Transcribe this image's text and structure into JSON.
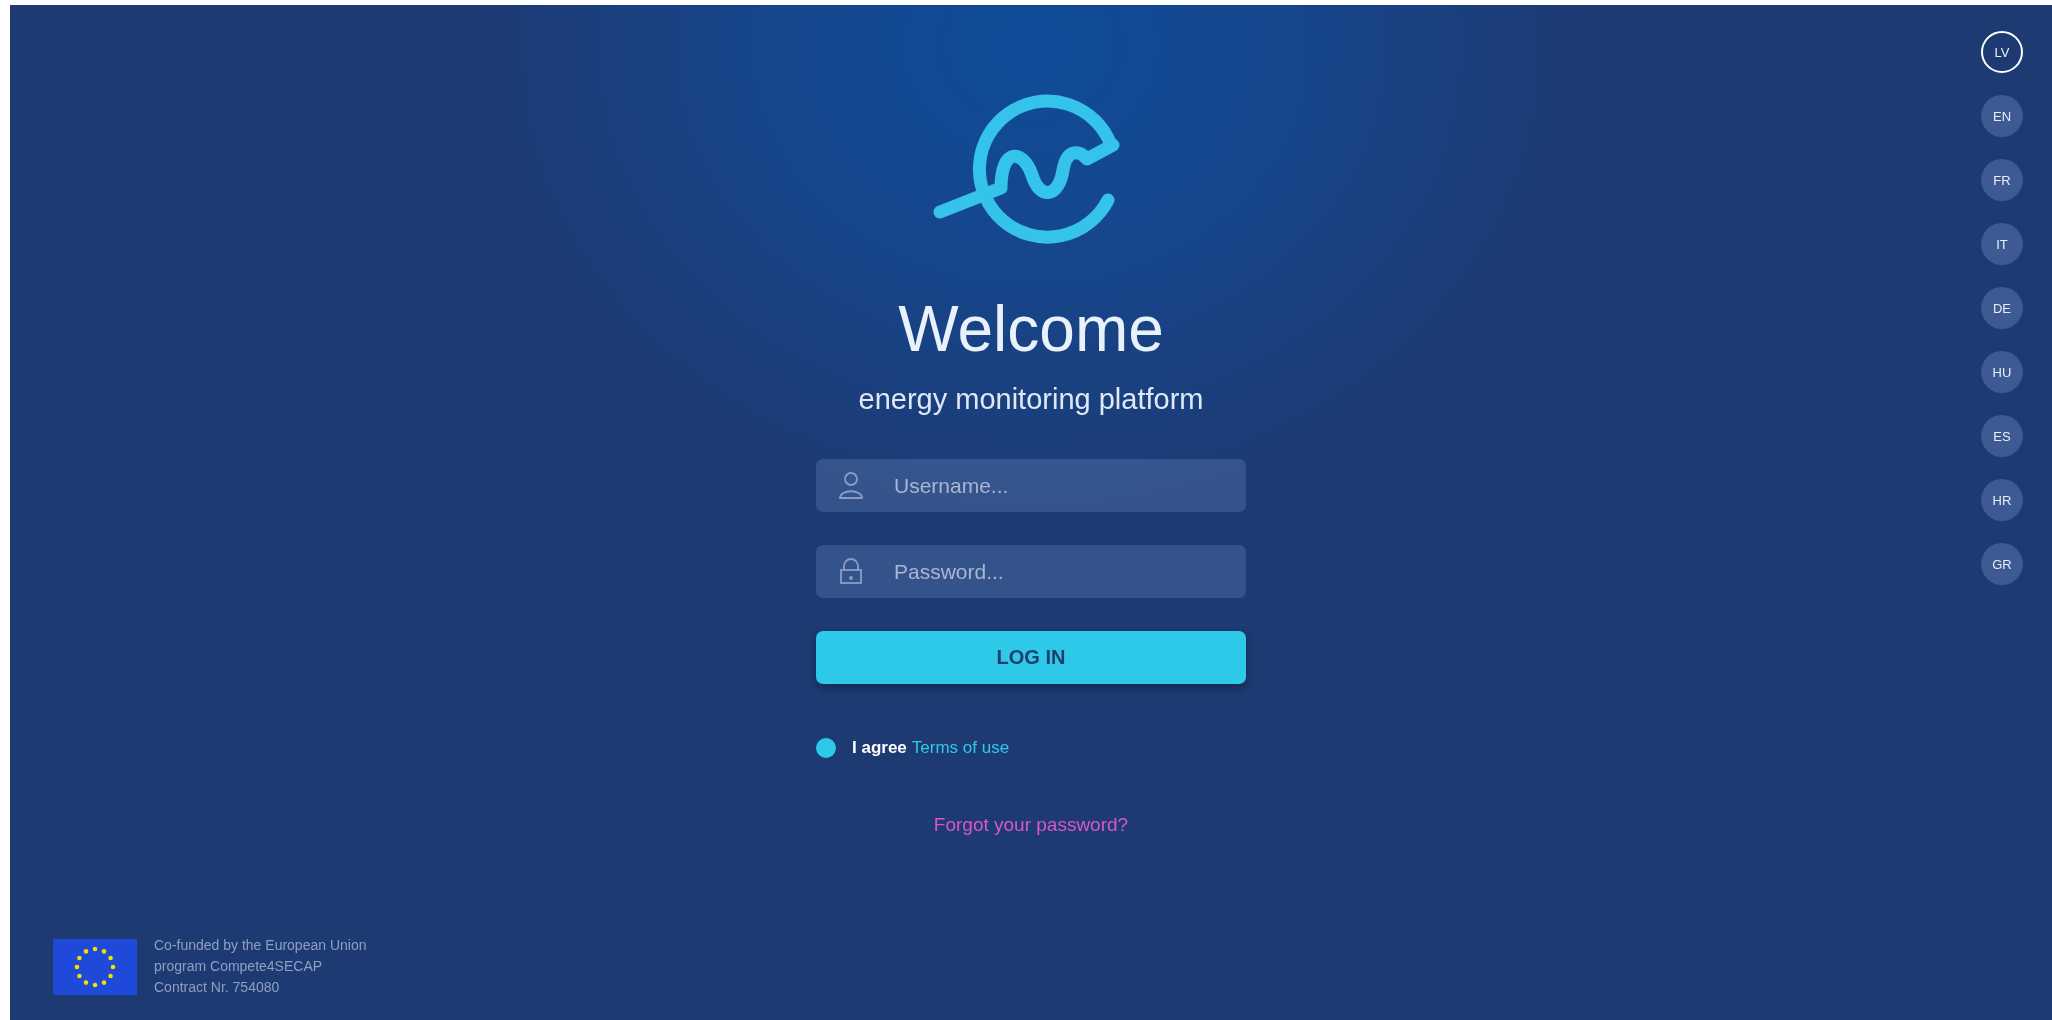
{
  "heading": "Welcome",
  "subtitle": "energy monitoring platform",
  "username": {
    "placeholder": "Username..."
  },
  "password": {
    "placeholder": "Password..."
  },
  "login_button": "LOG IN",
  "agreement": {
    "checked": true,
    "text": "I agree",
    "link": "Terms of use"
  },
  "forgot_link": "Forgot your password?",
  "languages": [
    {
      "code": "LV",
      "selected": true
    },
    {
      "code": "EN",
      "selected": false
    },
    {
      "code": "FR",
      "selected": false
    },
    {
      "code": "IT",
      "selected": false
    },
    {
      "code": "DE",
      "selected": false
    },
    {
      "code": "HU",
      "selected": false
    },
    {
      "code": "ES",
      "selected": false
    },
    {
      "code": "HR",
      "selected": false
    },
    {
      "code": "GR",
      "selected": false
    }
  ],
  "footer": {
    "lines": [
      "Co-funded by the European Union",
      "program Compete4SECAP",
      "Contract Nr. 754080"
    ]
  }
}
